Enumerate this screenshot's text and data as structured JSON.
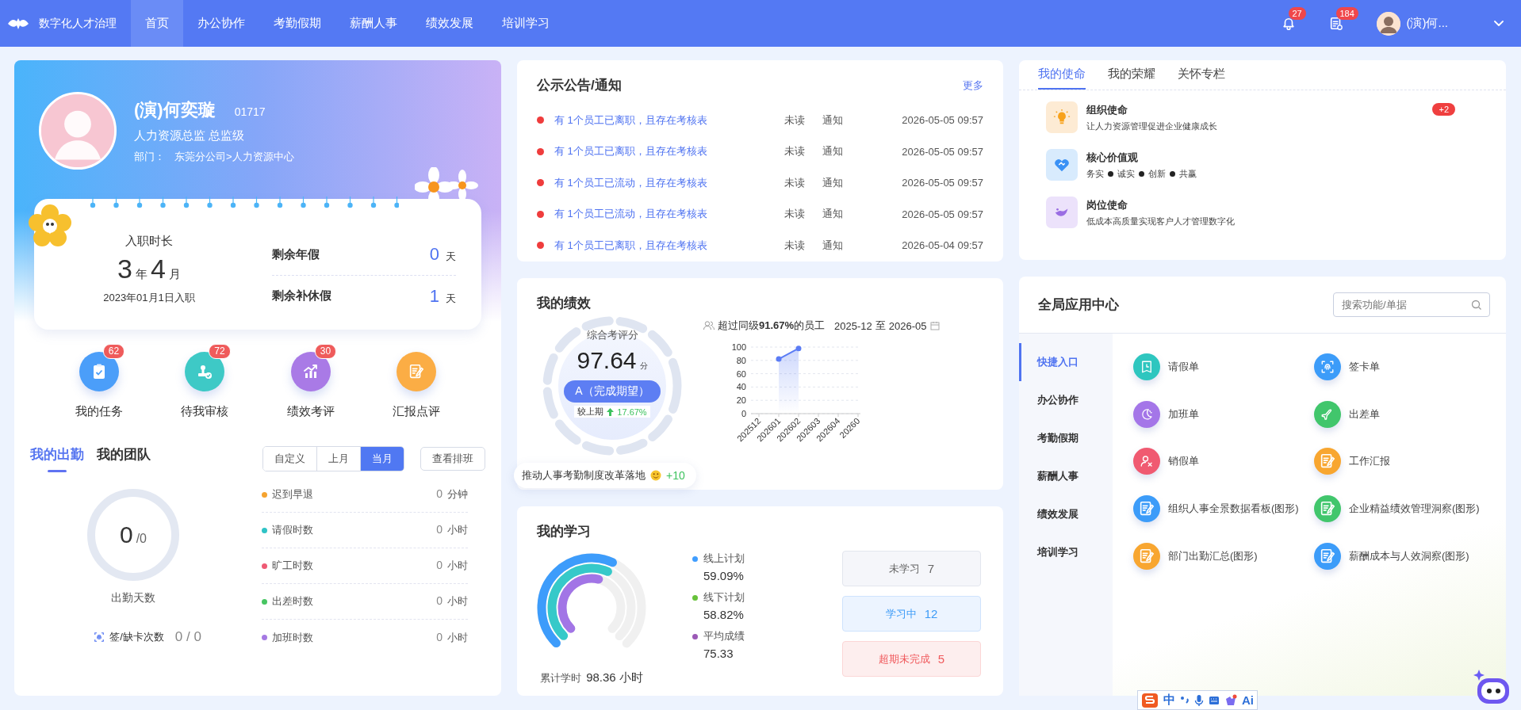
{
  "top_bar": {
    "logo_text": "数字化人才治理",
    "nav": [
      {
        "label": "首页",
        "selected": true
      },
      {
        "label": "办公协作",
        "selected": false
      },
      {
        "label": "考勤假期",
        "selected": false
      },
      {
        "label": "薪酬人事",
        "selected": false
      },
      {
        "label": "绩效发展",
        "selected": false
      },
      {
        "label": "培训学习",
        "selected": false
      }
    ],
    "notification_badge": "27",
    "task_badge": "184",
    "user_name": "(演)何..."
  },
  "profile": {
    "name": "(演)何奕璇",
    "employee_id": "01717",
    "position": "人力资源总监 总监级",
    "department_label": "部门：",
    "department": "东莞分公司>人力资源中心"
  },
  "tenure": {
    "title": "入职时长",
    "years": "3",
    "year_unit": "年",
    "months": "4",
    "month_unit": "月",
    "hire_date": "2023年01月1日入职"
  },
  "leave": [
    {
      "label": "剩余年假",
      "value": "0",
      "unit": "天"
    },
    {
      "label": "剩余补休假",
      "value": "1",
      "unit": "天"
    }
  ],
  "shortcuts": [
    {
      "label": "我的任务",
      "badge": "62",
      "kind": "task",
      "color": "#4b9ef9"
    },
    {
      "label": "待我审核",
      "badge": "72",
      "kind": "review",
      "color": "#3ec9c6"
    },
    {
      "label": "绩效考评",
      "badge": "30",
      "kind": "chart",
      "color": "#a97ae6"
    },
    {
      "label": "汇报点评",
      "kind": "report",
      "color": "#fbad45"
    }
  ],
  "attendance": {
    "tabs": [
      {
        "label": "我的出勤",
        "selected": true
      },
      {
        "label": "我的团队",
        "selected": false
      }
    ],
    "periods": [
      {
        "label": "自定义",
        "selected": false
      },
      {
        "label": "上月",
        "selected": false
      },
      {
        "label": "当月",
        "selected": true
      }
    ],
    "schedule_button": "查看排班",
    "days_value": "0",
    "days_total": "/0",
    "days_label": "出勤天数",
    "punch_label": "签/缺卡次数",
    "punch_value": "0 / 0",
    "stats": [
      {
        "label": "迟到早退",
        "value": "0",
        "unit": "分钟",
        "color": "#f5a32f"
      },
      {
        "label": "请假时数",
        "value": "0",
        "unit": "小时",
        "color": "#2fc3c6"
      },
      {
        "label": "旷工时数",
        "value": "0",
        "unit": "小时",
        "color": "#ee5a74"
      },
      {
        "label": "出差时数",
        "value": "0",
        "unit": "小时",
        "color": "#47c562"
      },
      {
        "label": "加班时数",
        "value": "0",
        "unit": "小时",
        "color": "#a579e3"
      }
    ]
  },
  "notices": {
    "title": "公示公告/通知",
    "more": "更多",
    "rows": [
      {
        "text": "有 1个员工已离职，且存在考核表",
        "status": "未读",
        "type": "通知",
        "time": "2026-05-05 09:57"
      },
      {
        "text": "有 1个员工已离职，且存在考核表",
        "status": "未读",
        "type": "通知",
        "time": "2026-05-05 09:57"
      },
      {
        "text": "有 1个员工已流动，且存在考核表",
        "status": "未读",
        "type": "通知",
        "time": "2026-05-05 09:57"
      },
      {
        "text": "有 1个员工已流动，且存在考核表",
        "status": "未读",
        "type": "通知",
        "time": "2026-05-05 09:57"
      },
      {
        "text": "有 1个员工已离职，且存在考核表",
        "status": "未读",
        "type": "通知",
        "time": "2026-05-04 09:57"
      }
    ]
  },
  "performance": {
    "title": "我的绩效",
    "score_label": "综合考评分",
    "score": "97.64",
    "score_unit": "分",
    "grade": "A（完成期望）",
    "compare_label": "较上期",
    "change": "17.67%",
    "ranking": "超过同级**91.67%**的员工",
    "period_start": "2025-12",
    "period_to": "至",
    "period_end": "2026-05",
    "highlight": "推动人事考勤制度改革落地",
    "highlight_points": "+10",
    "chart_data": {
      "type": "area",
      "categories": [
        "202512",
        "202601",
        "202602",
        "202603",
        "202604",
        "20260"
      ],
      "series": [
        {
          "color": "#5b7cf5",
          "values": [
            null,
            82,
            98,
            null,
            null,
            null
          ]
        }
      ],
      "ylim": [
        0,
        100
      ],
      "grid": true,
      "yticks": [
        0,
        20,
        40,
        60,
        80,
        100
      ]
    }
  },
  "learning": {
    "title": "我的学习",
    "total_label": "累计学时",
    "total_value": "98.36 小时",
    "metrics": [
      {
        "label": "线上计划",
        "value": "59.09%",
        "color": "#409eff",
        "level": 0.5909
      },
      {
        "label": "线下计划",
        "value": "58.82%",
        "color": "#67c23a",
        "level": 0.5882
      },
      {
        "label": "平均成绩",
        "value": "75.33",
        "color": "#9b59b6",
        "level": 0.55
      }
    ],
    "statuses": [
      {
        "label": "未学习",
        "count": "7",
        "kind": "neutral"
      },
      {
        "label": "学习中",
        "count": "12",
        "kind": "info"
      },
      {
        "label": "超期未完成",
        "count": "5",
        "kind": "danger"
      }
    ]
  },
  "mission": {
    "tabs": [
      {
        "label": "我的使命",
        "selected": true
      },
      {
        "label": "我的荣耀",
        "selected": false
      },
      {
        "label": "关怀专栏",
        "selected": false
      }
    ],
    "items": [
      {
        "title": "组织使命",
        "text": "让人力资源管理促进企业健康成长",
        "badge": "+2",
        "kind": "bulb"
      },
      {
        "title": "核心价值观",
        "values": [
          "务实",
          "诚实",
          "创新",
          "共赢"
        ],
        "kind": "heart"
      },
      {
        "title": "岗位使命",
        "text": "低成本高质量实现客户人才管理数字化",
        "kind": "bird"
      }
    ]
  },
  "app_center": {
    "title": "全局应用中心",
    "search": {
      "placeholder": "搜索功能/单据"
    },
    "categories": [
      {
        "label": "快捷入口",
        "selected": true
      },
      {
        "label": "办公协作",
        "selected": false
      },
      {
        "label": "考勤假期",
        "selected": false
      },
      {
        "label": "薪酬人事",
        "selected": false
      },
      {
        "label": "绩效发展",
        "selected": false
      },
      {
        "label": "培训学习",
        "selected": false
      }
    ],
    "apps": [
      {
        "label": "请假单",
        "kind": "leave",
        "color": "#2ec6bf"
      },
      {
        "label": "签卡单",
        "kind": "punch",
        "color": "#3c9cf9"
      },
      {
        "label": "加班单",
        "kind": "overtime",
        "color": "#a476e8"
      },
      {
        "label": "出差单",
        "kind": "trip",
        "color": "#41c66c"
      },
      {
        "label": "销假单",
        "kind": "cancel",
        "color": "#f05a71"
      },
      {
        "label": "工作汇报",
        "kind": "report",
        "color": "#f8a630"
      },
      {
        "label": "组织人事全景数据看板(图形)",
        "kind": "report",
        "color": "#3c9cf9"
      },
      {
        "label": "企业精益绩效管理洞察(图形)",
        "kind": "report",
        "color": "#41c66c"
      },
      {
        "label": "部门出勤汇总(图形)",
        "kind": "report",
        "color": "#f8a630"
      },
      {
        "label": "薪酬成本与人效洞察(图形)",
        "kind": "report",
        "color": "#3c9cf9"
      }
    ]
  },
  "ime_toolbar": {
    "language": "中",
    "ai": "Ai"
  }
}
